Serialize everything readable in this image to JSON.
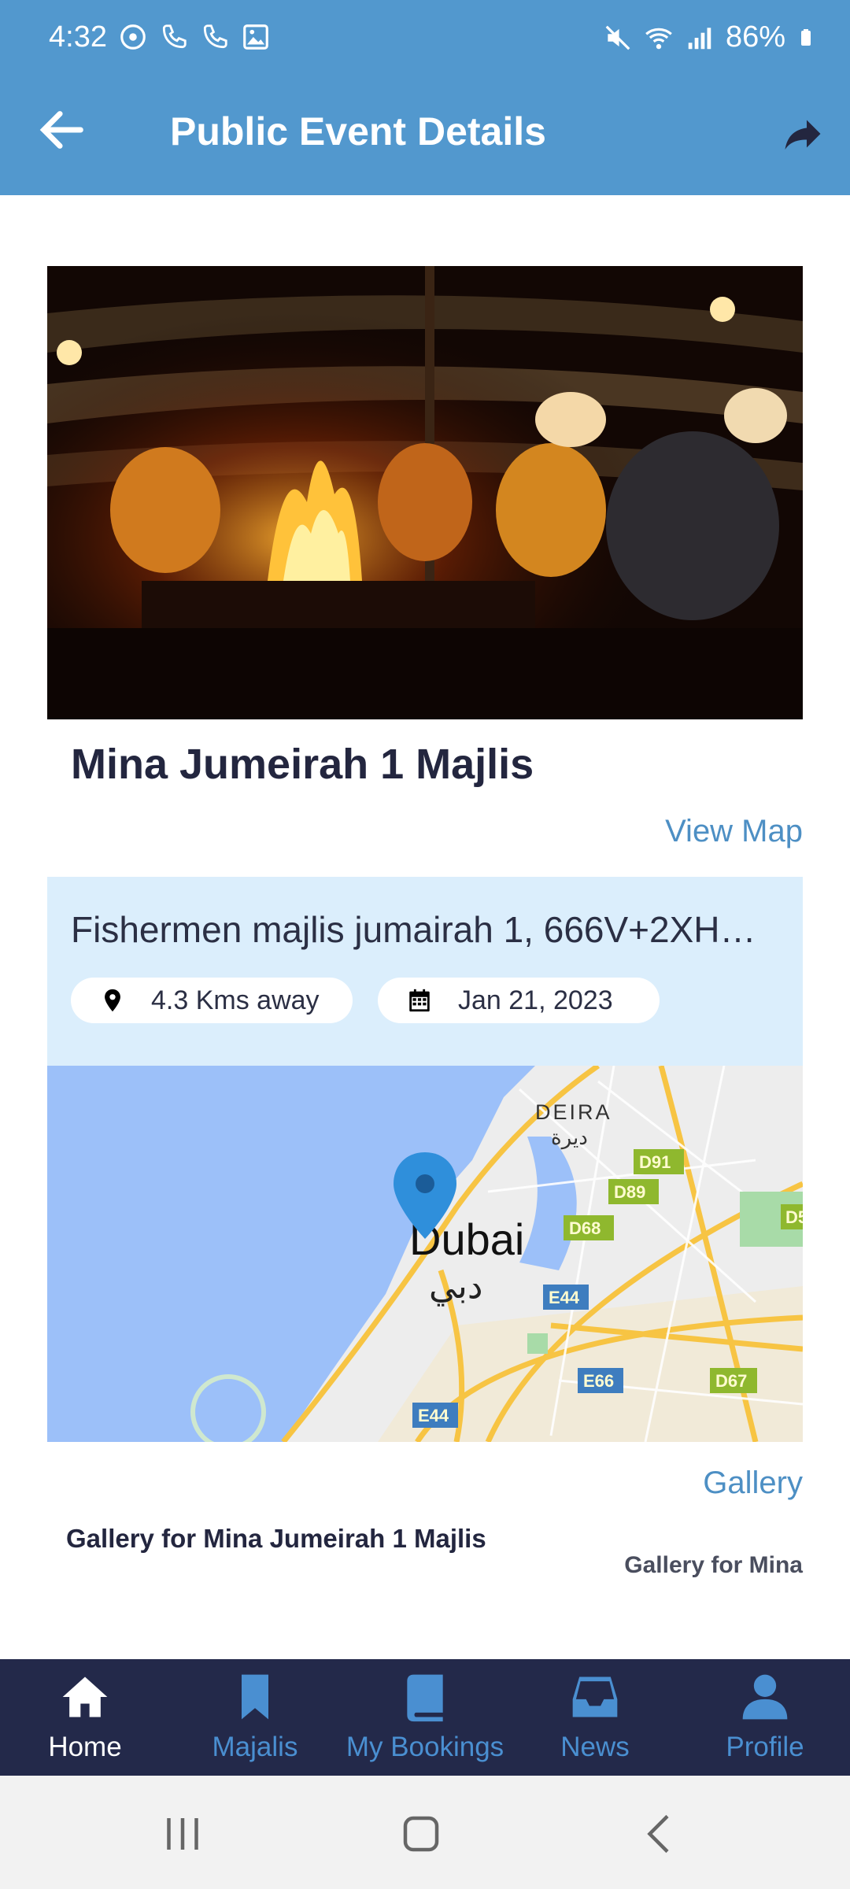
{
  "status_bar": {
    "time": "4:32",
    "battery": "86%",
    "icons_left": [
      "sync-icon",
      "phone-icon",
      "phone-icon",
      "image-icon"
    ],
    "icons_right": [
      "mute-icon",
      "wifi-icon",
      "signal-icon",
      "battery-icon"
    ]
  },
  "app_bar": {
    "title": "Public Event Details",
    "back_icon": "arrow-left-icon",
    "share_icon": "share-icon"
  },
  "event": {
    "title": "Mina Jumeirah 1 Majlis",
    "view_map_label": "View Map",
    "address": "Fishermen majlis jumairah 1, 666V+2XH…",
    "distance": "4.3 Kms away",
    "date": "Jan  21, 2023"
  },
  "map": {
    "labels": {
      "district": "DEIRA",
      "district_ar": "ديرة",
      "city": "Dubai",
      "city_ar": "دبي",
      "roads": [
        "D91",
        "D89",
        "D68",
        "E44",
        "E66",
        "E44",
        "D67",
        "D5"
      ]
    }
  },
  "gallery": {
    "link_label": "Gallery",
    "caption": "Gallery for Mina Jumeirah 1 Majlis",
    "caption_secondary": "Gallery for Mina"
  },
  "bottom_nav": {
    "items": [
      {
        "label": "Home",
        "icon": "home-icon",
        "active": true
      },
      {
        "label": "Majalis",
        "icon": "bookmark-icon",
        "active": false
      },
      {
        "label": "My Bookings",
        "icon": "book-icon",
        "active": false
      },
      {
        "label": "News",
        "icon": "inbox-icon",
        "active": false
      },
      {
        "label": "Profile",
        "icon": "person-icon",
        "active": false
      }
    ]
  },
  "colors": {
    "header": "#5298ce",
    "nav_bg": "#23294a",
    "accent": "#4d8fc4",
    "info_panel": "#dbeefc"
  }
}
